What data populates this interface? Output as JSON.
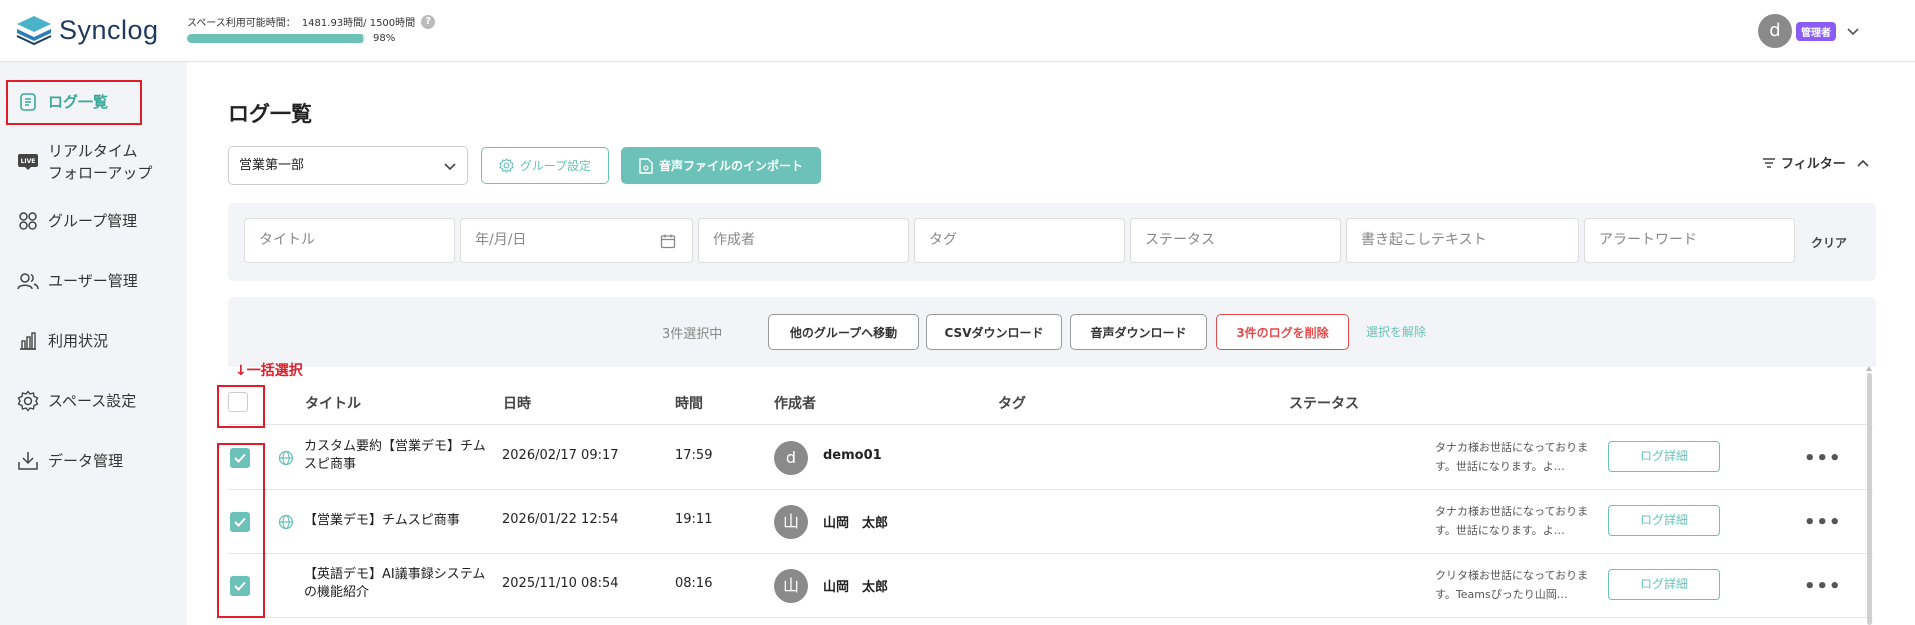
{
  "app": {
    "name": "Synclog"
  },
  "header": {
    "usage_label": "スペース利用可能時間：",
    "usage_value": "1481.93時間/ 1500時間",
    "usage_percent": "98%",
    "usage_fill": 0.988,
    "avatar_initial": "d",
    "role": "管理者"
  },
  "sidebar": {
    "items": [
      {
        "label": "ログ一覧",
        "icon": "log-list-icon",
        "active": true
      },
      {
        "label": "リアルタイム\nフォローアップ",
        "icon": "live-icon"
      },
      {
        "label": "グループ管理",
        "icon": "group-grid-icon"
      },
      {
        "label": "ユーザー管理",
        "icon": "users-icon"
      },
      {
        "label": "利用状況",
        "icon": "bar-chart-icon"
      },
      {
        "label": "スペース設定",
        "icon": "gear-icon"
      },
      {
        "label": "データ管理",
        "icon": "download-tray-icon"
      }
    ]
  },
  "main": {
    "title": "ログ一覧",
    "group_select": "営業第一部",
    "group_settings_label": "グループ設定",
    "import_label": "音声ファイルのインポート",
    "filter_toggle_label": "フィルター"
  },
  "filters": {
    "title_placeholder": "タイトル",
    "date_placeholder": "年/月/日",
    "author_placeholder": "作成者",
    "tag_placeholder": "タグ",
    "status_placeholder": "ステータス",
    "transcript_placeholder": "書き起こしテキスト",
    "alert_placeholder": "アラートワード",
    "clear_label": "クリア"
  },
  "actions": {
    "selected_count": "3件選択中",
    "move_label": "他のグループへ移動",
    "csv_label": "CSVダウンロード",
    "audio_label": "音声ダウンロード",
    "delete_label": "3件のログを削除",
    "deselect_label": "選択を解除"
  },
  "annotation": {
    "bulk_select": "↓一括選択"
  },
  "table": {
    "headers": {
      "title": "タイトル",
      "datetime": "日時",
      "duration": "時間",
      "author": "作成者",
      "tag": "タグ",
      "status": "ステータス"
    },
    "detail_label": "ログ詳細",
    "rows": [
      {
        "title": "カスタム要約【営業デモ】チムスピ商事",
        "datetime": "2026/02/17 09:17",
        "duration": "17:59",
        "author_initial": "d",
        "author": "demo01",
        "summary": "タナカ様お世話になっております。世話になります。よ…",
        "checked": true,
        "globe": true
      },
      {
        "title": "【営業デモ】チムスピ商事",
        "datetime": "2026/01/22 12:54",
        "duration": "19:11",
        "author_initial": "山",
        "author": "山岡　太郎",
        "summary": "タナカ様お世話になっております。世話になります。よ…",
        "checked": true,
        "globe": true
      },
      {
        "title": "【英語デモ】AI議事録システムの機能紹介",
        "datetime": "2025/11/10 08:54",
        "duration": "08:16",
        "author_initial": "山",
        "author": "山岡　太郎",
        "summary": "クリタ様お世話になっております。Teamsぴったり山岡…",
        "checked": true,
        "globe": false
      }
    ]
  },
  "colors": {
    "accent": "#6cc2b8",
    "danger": "#e54b4b",
    "highlight": "#e11d2a",
    "role_badge": "#8b5cf6"
  }
}
